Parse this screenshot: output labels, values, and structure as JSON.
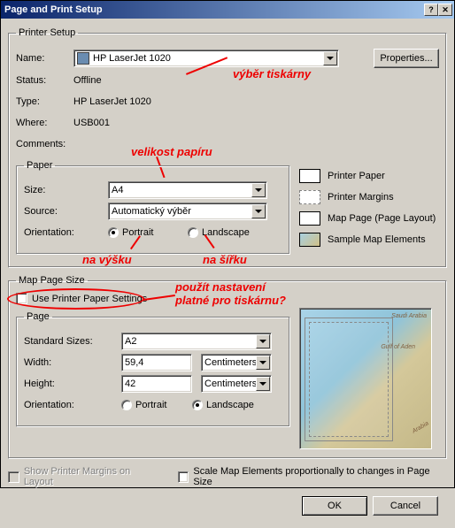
{
  "window": {
    "title": "Page and Print Setup"
  },
  "annotations": {
    "printer_choice": "výběr tiskárny",
    "paper_size": "velikost papíru",
    "portrait_cz": "na výšku",
    "landscape_cz": "na šířku",
    "use_printer_1": "použít nastavení",
    "use_printer_2": "platné pro tiskárnu?"
  },
  "printer": {
    "group": "Printer Setup",
    "name_label": "Name:",
    "name_value": "HP LaserJet 1020",
    "properties_btn": "Properties...",
    "status_label": "Status:",
    "status_value": "Offline",
    "type_label": "Type:",
    "type_value": "HP LaserJet 1020",
    "where_label": "Where:",
    "where_value": "USB001",
    "comments_label": "Comments:"
  },
  "paper": {
    "group": "Paper",
    "size_label": "Size:",
    "size_value": "A4",
    "source_label": "Source:",
    "source_value": "Automatický výběr",
    "orientation_label": "Orientation:",
    "portrait": "Portrait",
    "landscape": "Landscape"
  },
  "legend": {
    "printer_paper": "Printer Paper",
    "printer_margins": "Printer Margins",
    "map_page": "Map Page (Page Layout)",
    "sample_elements": "Sample Map Elements"
  },
  "map_page": {
    "group": "Map Page Size",
    "use_printer": "Use Printer Paper Settings",
    "page_group": "Page",
    "std_label": "Standard Sizes:",
    "std_value": "A2",
    "width_label": "Width:",
    "width_value": "59,4",
    "width_units": "Centimeters",
    "height_label": "Height:",
    "height_value": "42",
    "height_units": "Centimeters",
    "orientation_label": "Orientation:",
    "portrait": "Portrait",
    "landscape": "Landscape"
  },
  "footer": {
    "show_margins": "Show Printer Margins on Layout",
    "scale_elements": "Scale Map Elements proportionally to changes in Page Size",
    "ok": "OK",
    "cancel": "Cancel"
  },
  "map_labels": {
    "gulf": "Gulf of Aden",
    "saudi": "Saudi Arabia",
    "arabia": "Arabia"
  }
}
